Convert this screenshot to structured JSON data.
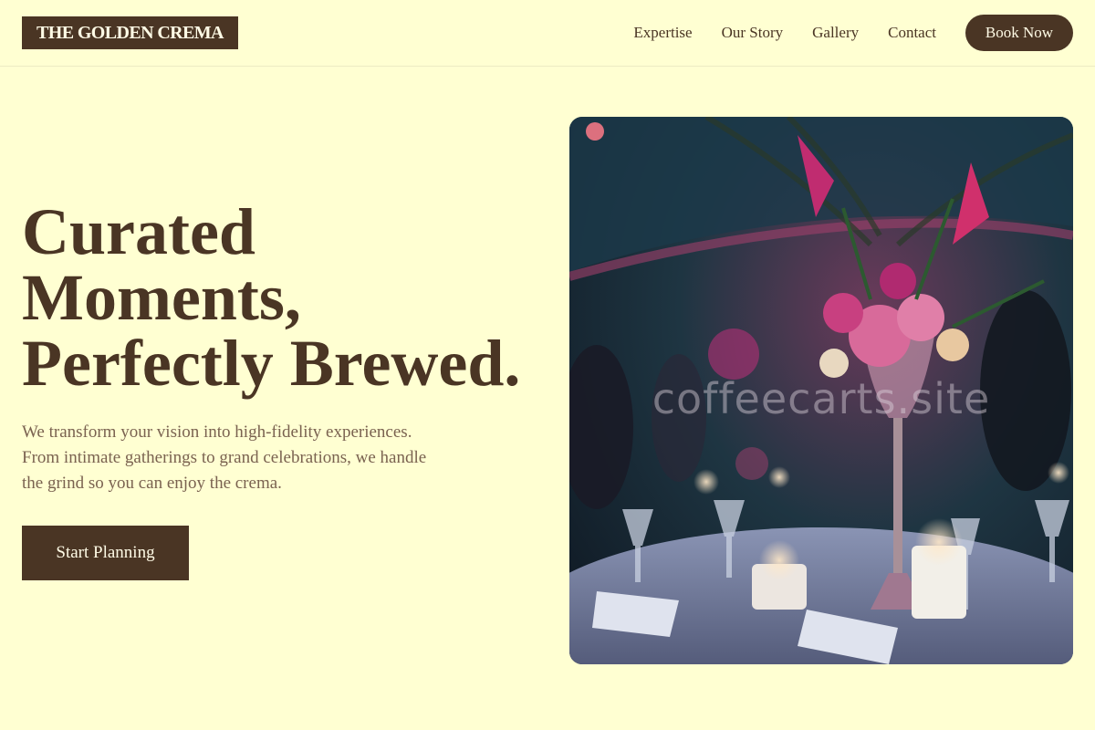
{
  "brand": {
    "logo_text": "THE GOLDEN CREMA"
  },
  "nav": {
    "links": [
      "Expertise",
      "Our Story",
      "Gallery",
      "Contact"
    ],
    "book_label": "Book Now"
  },
  "hero": {
    "title_lines": [
      "Curated",
      "Moments,",
      "Perfectly Brewed."
    ],
    "subtitle": "We transform your vision into high-fidelity experiences. From intimate gatherings to grand celebrations, we handle the grind so you can enjoy the crema.",
    "cta_label": "Start Planning",
    "image_watermark": "coffeecarts.site"
  },
  "colors": {
    "background": "#ffffd2",
    "primary": "#4a3524",
    "body_text": "#7a6250"
  }
}
